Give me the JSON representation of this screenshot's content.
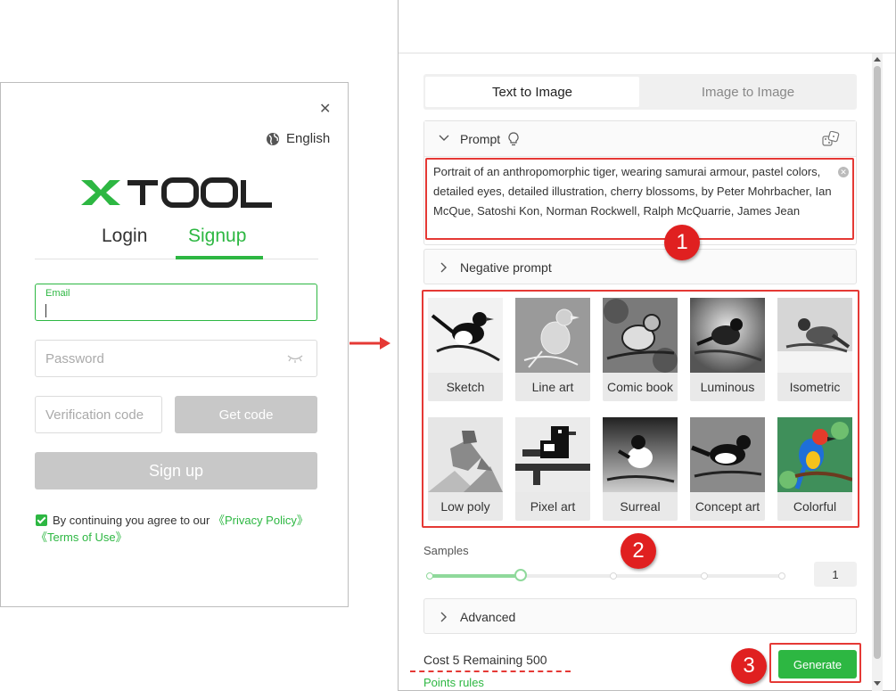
{
  "login": {
    "language": "English",
    "logo_text": "XTOOL",
    "tabs": {
      "login": "Login",
      "signup": "Signup"
    },
    "email_label": "Email",
    "password_placeholder": "Password",
    "code_placeholder": "Verification code",
    "get_code": "Get code",
    "sign_up": "Sign up",
    "agree_text": "By continuing you agree to our ",
    "privacy": "《Privacy Policy》",
    "terms": "《Terms of Use》"
  },
  "panel": {
    "tabs": {
      "text_to_image": "Text to Image",
      "image_to_image": "Image to Image"
    },
    "prompt_label": "Prompt",
    "prompt_text": "Portrait of an anthropomorphic tiger, wearing samurai armour, pastel colors, detailed eyes, detailed illustration, cherry blossoms, by Peter Mohrbacher, Ian McQue, Satoshi Kon, Norman Rockwell, Ralph McQuarrie, James Jean",
    "negative_label": "Negative prompt",
    "styles": [
      "Sketch",
      "Line art",
      "Comic book",
      "Luminous",
      "Isometric",
      "Low poly",
      "Pixel art",
      "Surreal",
      "Concept art",
      "Colorful"
    ],
    "samples_label": "Samples",
    "samples_value": "1",
    "advanced_label": "Advanced",
    "cost_text": "Cost 5 Remaining 500",
    "points_rules": "Points rules",
    "generate": "Generate"
  },
  "annotations": [
    "1",
    "2",
    "3"
  ],
  "colors": {
    "accent": "#2db742",
    "annotation": "#e02020"
  }
}
